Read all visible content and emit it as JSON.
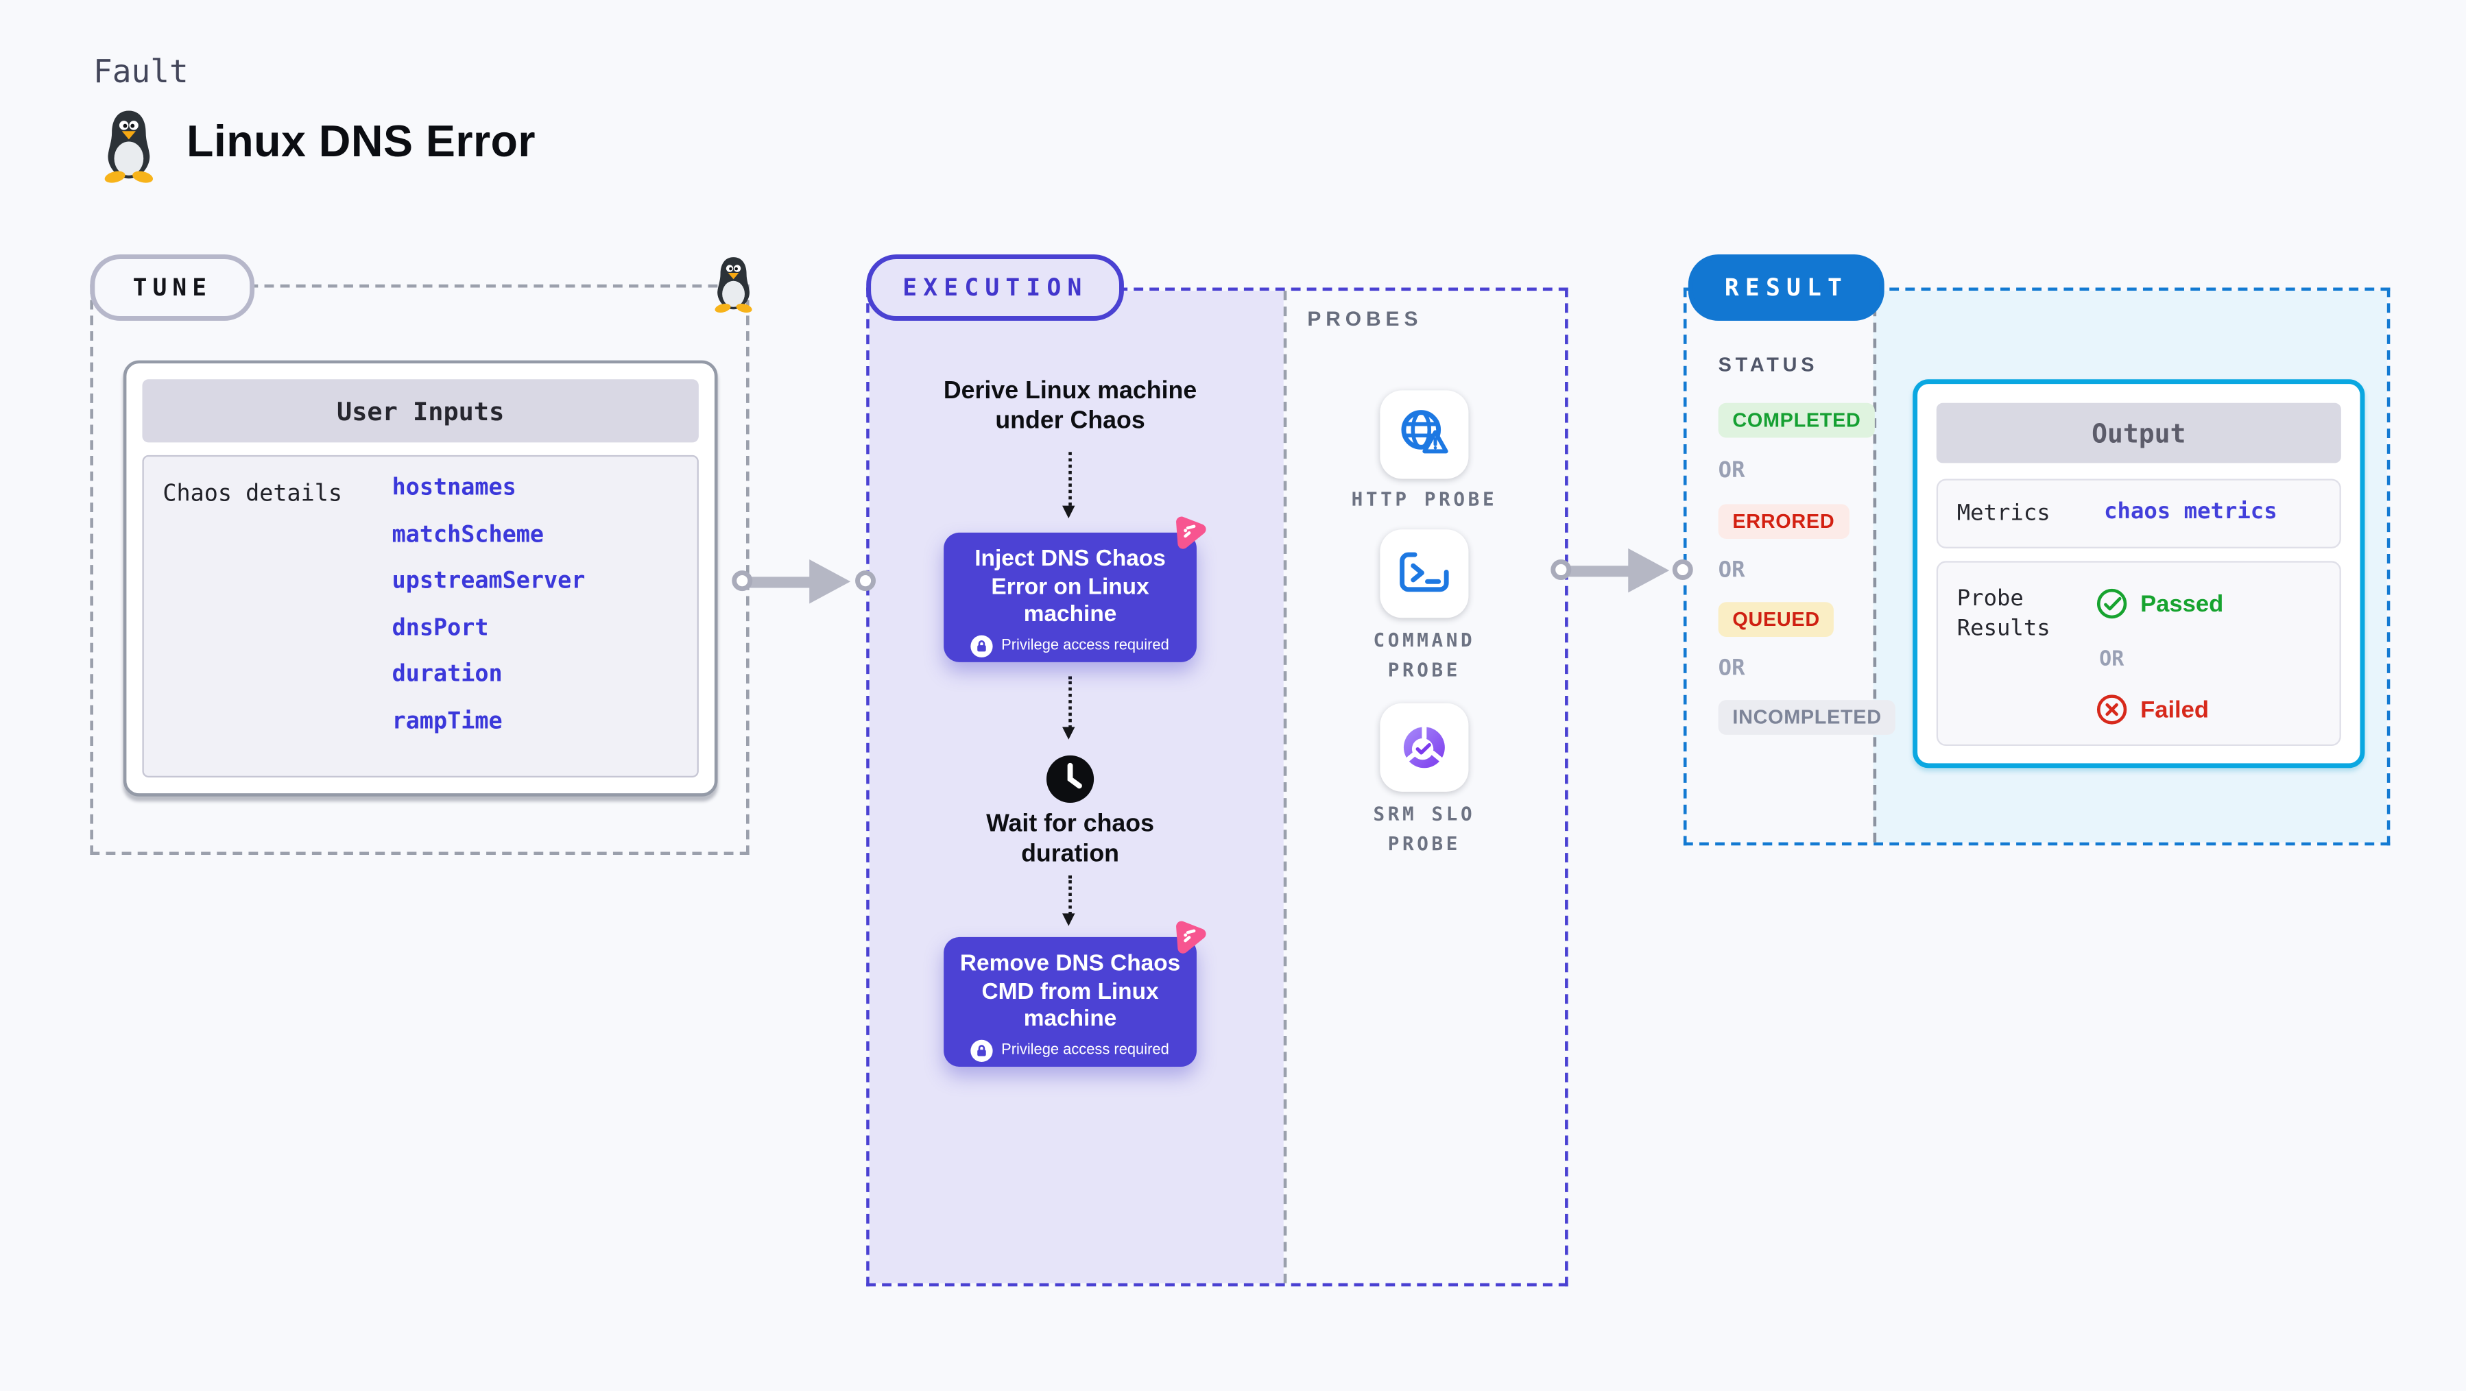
{
  "page": {
    "kicker": "Fault",
    "title": "Linux DNS Error"
  },
  "tune": {
    "label": "TUNE",
    "table": {
      "header": "User Inputs",
      "row_label": "Chaos details",
      "params": [
        "hostnames",
        "matchScheme",
        "upstreamServer",
        "dnsPort",
        "duration",
        "rampTime"
      ]
    }
  },
  "execution": {
    "label": "EXECUTION",
    "steps": {
      "derive": "Derive Linux machine under Chaos",
      "inject": "Inject DNS Chaos Error on Linux machine",
      "wait": "Wait for chaos duration",
      "remove": "Remove DNS Chaos CMD from Linux machine",
      "privilege": "Privilege access required"
    },
    "probes": {
      "label": "PROBES",
      "items": [
        {
          "name": "HTTP PROBE",
          "icon": "globe-alert-icon"
        },
        {
          "name": "COMMAND PROBE",
          "icon": "terminal-icon"
        },
        {
          "name": "SRM SLO PROBE",
          "icon": "slo-donut-check-icon"
        }
      ]
    }
  },
  "result": {
    "label": "RESULT",
    "status": {
      "label": "STATUS",
      "or": "OR",
      "badges": [
        "COMPLETED",
        "ERRORED",
        "QUEUED",
        "INCOMPLETED"
      ]
    },
    "output": {
      "header": "Output",
      "metrics_label": "Metrics",
      "metrics_value": "chaos metrics",
      "probe_results_label": "Probe Results",
      "passed": "Passed",
      "or": "OR",
      "failed": "Failed"
    }
  },
  "colors": {
    "page_bg": "#f8f9fc",
    "indigo": "#4c42d4",
    "lavender": "#e6e4f9",
    "result_blue": "#1277d2",
    "output_cyan": "#0aa7e1",
    "cyan_fill": "#e8f5fc",
    "param_blue": "#3b38da",
    "green": "#17a32f",
    "red": "#d7291b",
    "queued_bg": "#faeec5",
    "completed_bg": "#dff3df",
    "errored_bg": "#fcebe8",
    "pink": "#f75590",
    "probe_icon_blue": "#1d78e2",
    "slo_purple": "#7c3aed"
  }
}
